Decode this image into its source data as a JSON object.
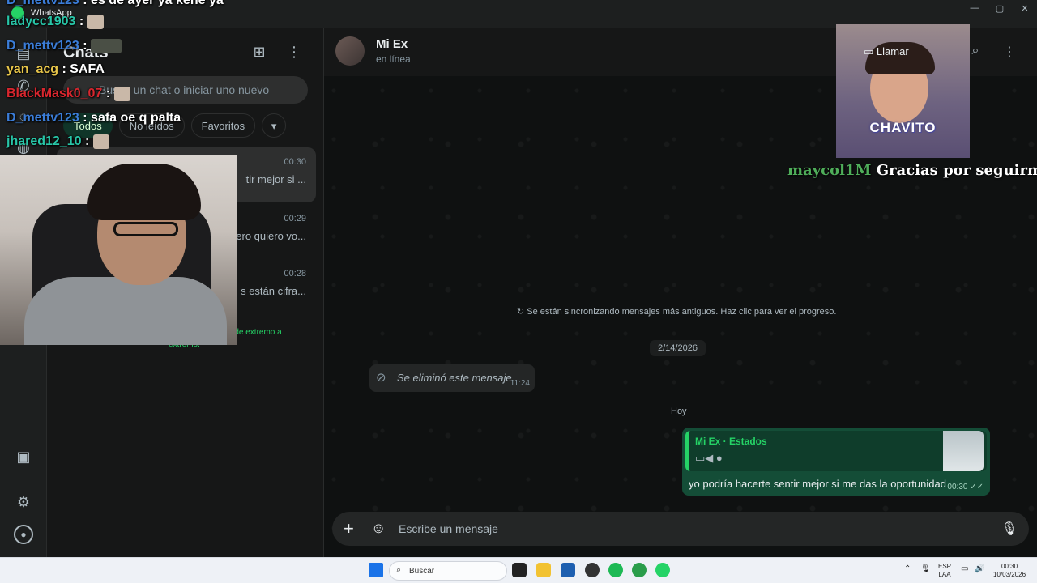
{
  "titlebar": {
    "app_name": "WhatsApp",
    "minimize": "—",
    "maximize": "▢",
    "close": "✕"
  },
  "rail": {
    "items": [
      "chats-icon",
      "calls-icon",
      "status-icon",
      "channels-icon",
      "media-icon",
      "settings-icon",
      "profile-icon"
    ]
  },
  "sidebar": {
    "title": "Chats",
    "search_placeholder": "Busca un chat o iniciar uno nuevo",
    "filters": [
      "Todos",
      "No leídos",
      "Favoritos"
    ],
    "chats": [
      {
        "time": "00:30",
        "preview": "tir mejor si ..."
      },
      {
        "time": "00:29",
        "preview": "ero quiero vo..."
      },
      {
        "time": "00:28",
        "preview": "s están cifra..."
      }
    ],
    "encryption_note": "os de extremo a",
    "encryption_note2": "extremo."
  },
  "conversation": {
    "contact_name": "Mi Ex",
    "contact_status": "en línea",
    "call_label": "Llamar",
    "sync_notice": "Se están sincronizando mensajes más antiguos. Haz clic para ver el progreso.",
    "date_1": "2/14/2026",
    "deleted_text": "Se eliminó este mensaje.",
    "deleted_time": "11:24",
    "date_2": "Hoy",
    "reply_source": "Mi Ex · Estados",
    "outgoing_text": "yo podría hacerte sentir mejor si me das la oportunidad",
    "outgoing_time": "00:30",
    "composer_placeholder": "Escribe un mensaje"
  },
  "stream_chat": [
    {
      "user": "D_mettv123",
      "color": "#3b7dd8",
      "message": ": es de ayer ya kene ya"
    },
    {
      "user": "ladycc1903",
      "color": "#28c6a8",
      "message": ":"
    },
    {
      "user": "D_mettv123",
      "color": "#3b7dd8",
      "message": ":"
    },
    {
      "user": "yan_acg",
      "color": "#e8c64a",
      "message": ": SAFA"
    },
    {
      "user": "BlackMask0_07",
      "color": "#d8262e",
      "message": ":"
    },
    {
      "user": "D_mettv123",
      "color": "#3b7dd8",
      "message": ": safa oe q palta"
    },
    {
      "user": "jhared12_10",
      "color": "#28c6a8",
      "message": ":"
    }
  ],
  "kid_cam": {
    "label": "CHAVITO"
  },
  "follow_alert": {
    "user": "maycol1M",
    "message": "Gracias por seguirme!!"
  },
  "taskbar": {
    "search_label": "Buscar",
    "lang_1": "ESP",
    "lang_2": "LAA",
    "time": "00:30",
    "date": "10/03/2026"
  }
}
